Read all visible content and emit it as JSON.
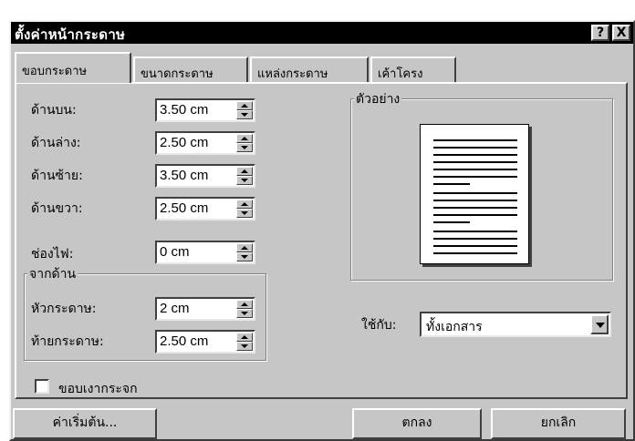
{
  "window": {
    "title": "ตั้งค่าหน้ากระดาษ",
    "help_label": "?",
    "close_label": "X"
  },
  "tabs": [
    {
      "label": "ขอบกระดาษ",
      "active": true
    },
    {
      "label": "ขนาดกระดาษ",
      "active": false
    },
    {
      "label": "แหล่งกระดาษ",
      "active": false
    },
    {
      "label": "เค้าโครง",
      "active": false
    }
  ],
  "margins": {
    "top": {
      "label": "ด้านบน:",
      "value": "3.50 cm"
    },
    "bottom": {
      "label": "ด้านล่าง:",
      "value": "2.50 cm"
    },
    "left": {
      "label": "ด้านซ้าย:",
      "value": "3.50 cm"
    },
    "right": {
      "label": "ด้านขวา:",
      "value": "2.50 cm"
    },
    "gutter": {
      "label": "ช่องไฟ:",
      "value": "0 cm"
    }
  },
  "from_edge": {
    "legend": "จากด้าน",
    "header": {
      "label": "หัวกระดาษ:",
      "value": "2 cm"
    },
    "footer": {
      "label": "ท้ายกระดาษ:",
      "value": "2.50 cm"
    }
  },
  "preview": {
    "legend": "ตัวอย่าง"
  },
  "apply_to": {
    "label": "ใช้กับ:",
    "value": "ทั้งเอกสาร"
  },
  "mirror_margins": {
    "label": "ขอบเงากระจก",
    "checked": false
  },
  "buttons": {
    "default": "ค่าเริ่มต้น...",
    "ok": "ตกลง",
    "cancel": "ยกเลิก"
  }
}
